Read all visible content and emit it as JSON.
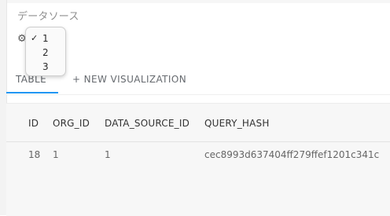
{
  "page": {
    "section_title": "データソース"
  },
  "source_selector": {
    "selected_value": "1",
    "icon": "gear-icon",
    "options": [
      {
        "label": "1",
        "checked": true
      },
      {
        "label": "2",
        "checked": false
      },
      {
        "label": "3",
        "checked": false
      }
    ]
  },
  "tabs": {
    "table_label": "TABLE",
    "new_visualization_label": "+ NEW VISUALIZATION",
    "active": "TABLE",
    "accent_color": "#2196f3"
  },
  "table": {
    "columns": [
      "ID",
      "ORG_ID",
      "DATA_SOURCE_ID",
      "QUERY_HASH"
    ],
    "rows": [
      [
        "18",
        "1",
        "1",
        "cec8993d637404ff279ffef1201c341c"
      ]
    ]
  }
}
